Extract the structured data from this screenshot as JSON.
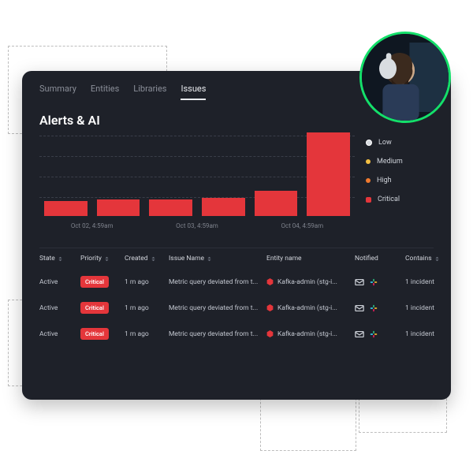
{
  "tabs": {
    "items": [
      "Summary",
      "Entities",
      "Libraries",
      "Issues"
    ],
    "active": "Issues"
  },
  "page_title": "Alerts & AI",
  "chart_data": {
    "type": "bar",
    "categories": [
      "Oct 02, 4:59am",
      "",
      "Oct 03, 4:59am",
      "",
      "Oct 04, 4:59am"
    ],
    "values": [
      18,
      20,
      20,
      22,
      30,
      100
    ],
    "title": "Alerts & AI",
    "xlabel": "",
    "ylabel": "",
    "ylim": [
      0,
      100
    ],
    "series_color": "#e4363b",
    "xticks": [
      "Oct 02, 4:59am",
      "Oct 03, 4:59am",
      "Oct 04, 4:59am"
    ]
  },
  "legend": [
    {
      "label": "Low",
      "key": "low"
    },
    {
      "label": "Medium",
      "key": "med"
    },
    {
      "label": "High",
      "key": "high"
    },
    {
      "label": "Critical",
      "key": "crit"
    }
  ],
  "table": {
    "columns": [
      "State",
      "Priority",
      "Created",
      "Issue  Name",
      "Entity name",
      "Notified",
      "Contains"
    ],
    "rows": [
      {
        "state": "Active",
        "priority": "Critical",
        "created": "1 m ago",
        "issue": "Metric query deviated from t...",
        "entity": "Kafka-admin (stg-i...",
        "contains": "1 incident"
      },
      {
        "state": "Active",
        "priority": "Critical",
        "created": "1 m ago",
        "issue": "Metric query deviated from t...",
        "entity": "Kafka-admin (stg-i...",
        "contains": "1 incident"
      },
      {
        "state": "Active",
        "priority": "Critical",
        "created": "1 m ago",
        "issue": "Metric query deviated from t...",
        "entity": "Kafka-admin (stg-i...",
        "contains": "1 incident"
      }
    ]
  }
}
